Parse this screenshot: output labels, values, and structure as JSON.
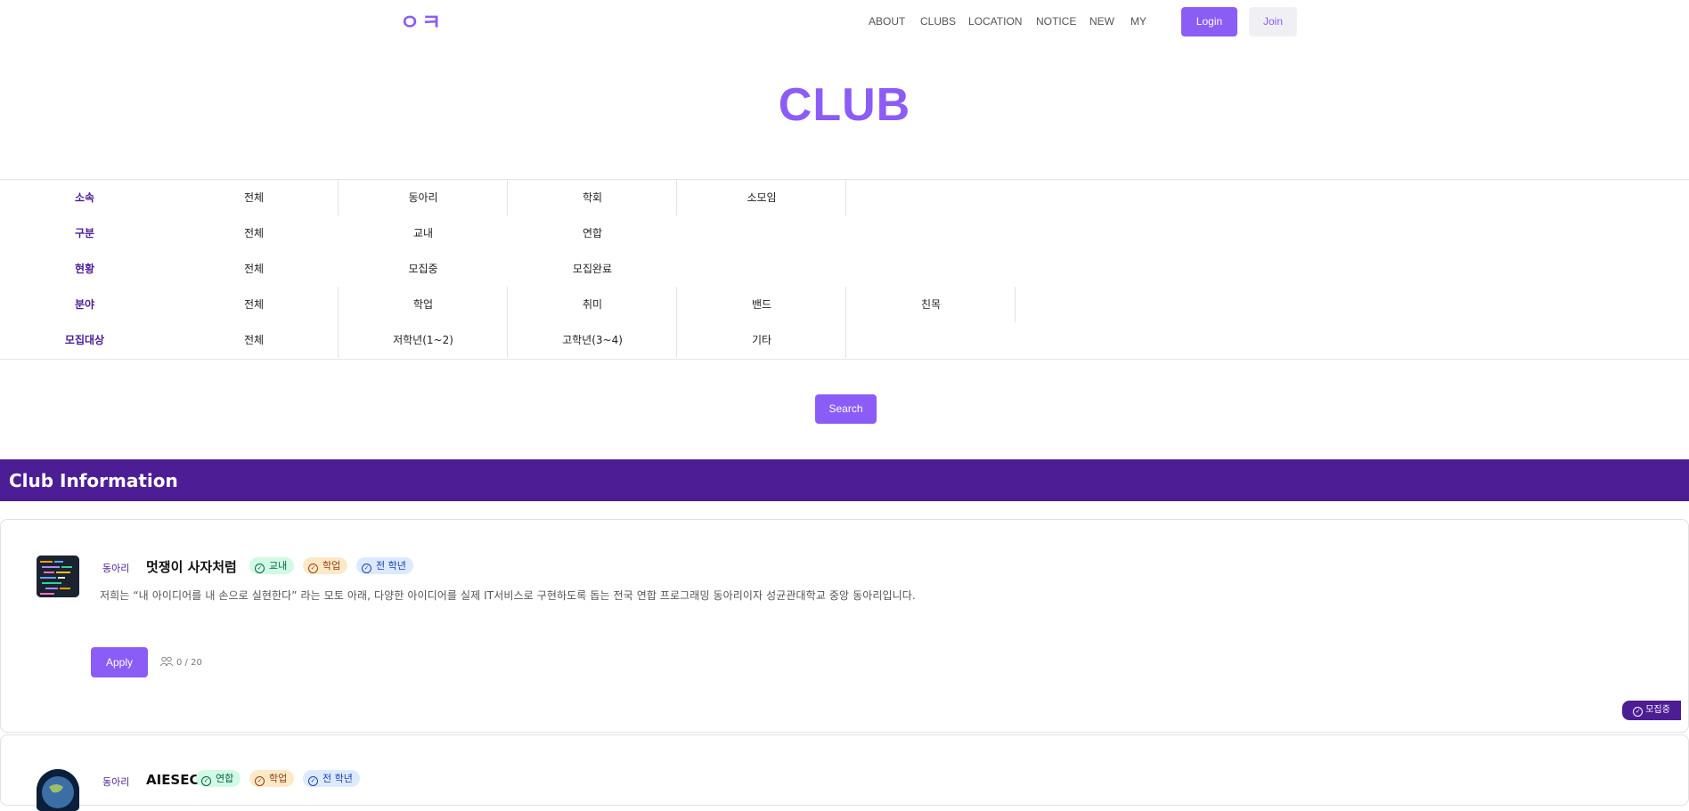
{
  "header": {
    "logo": "ㅇㅋ",
    "nav": [
      "ABOUT",
      "CLUBS",
      "LOCATION",
      "NOTICE",
      "NEW",
      "MY"
    ],
    "login_label": "Login",
    "join_label": "Join"
  },
  "page_title": "CLUB",
  "filters": [
    {
      "label": "소속",
      "options": [
        "전체",
        "동아리",
        "학회",
        "소모임"
      ]
    },
    {
      "label": "구분",
      "options": [
        "전체",
        "교내",
        "연합"
      ]
    },
    {
      "label": "현황",
      "options": [
        "전체",
        "모집중",
        "모집완료"
      ]
    },
    {
      "label": "분야",
      "options": [
        "전체",
        "학업",
        "취미",
        "밴드",
        "친목"
      ]
    },
    {
      "label": "모집대상",
      "options": [
        "전체",
        "저학년(1~2)",
        "고학년(3~4)",
        "기타"
      ]
    }
  ],
  "search_label": "Search",
  "section_title": "Club Information",
  "clubs": [
    {
      "category": "동아리",
      "name": "멋쟁이 사자처럼",
      "tags": [
        "교내",
        "학업",
        "전 학년"
      ],
      "description": "저희는 “내 아이디어를 내 손으로 실현한다” 라는 모토 아래, 다양한 아이디어를 실제 IT서비스로 구현하도록 돕는 전국 연합 프로그래밍 동아리이자 성균관대학교 중앙 동아리입니다.",
      "apply_label": "Apply",
      "capacity": "0 / 20",
      "status": "모집중"
    },
    {
      "category": "동아리",
      "name": "AIESEC",
      "tags": [
        "연합",
        "학업",
        "전 학년"
      ]
    }
  ],
  "colors": {
    "accent": "#8b5cf6",
    "dark_purple": "#4c1d95"
  }
}
